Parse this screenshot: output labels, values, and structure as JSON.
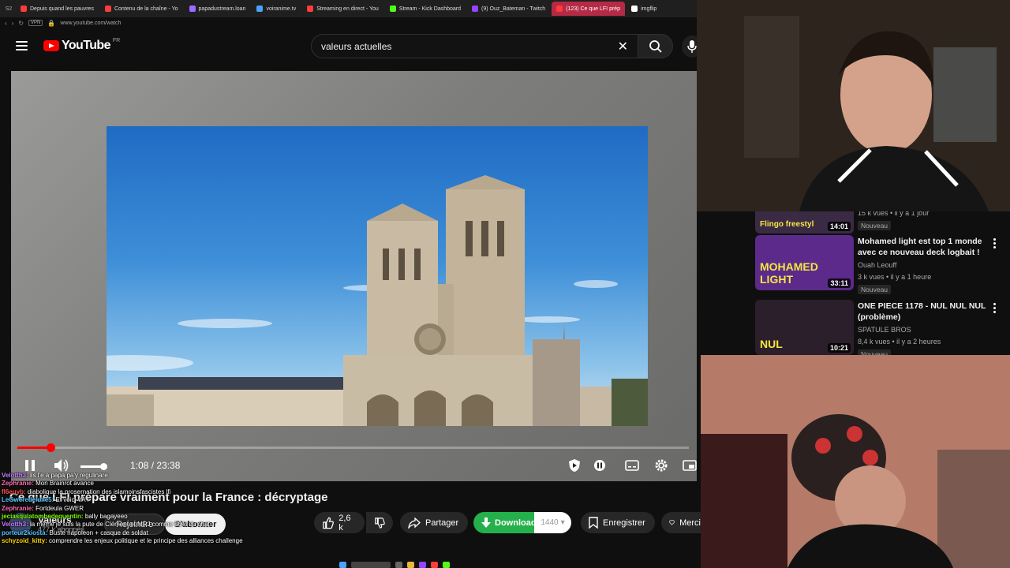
{
  "browser": {
    "tabs": [
      {
        "label": "Depuis quand les pauvres",
        "color": "#ff3b3b"
      },
      {
        "label": "Contenu de la chaîne - Yo",
        "color": "#ff3b3b"
      },
      {
        "label": "papadustream.loan",
        "color": "#9a6cff"
      },
      {
        "label": "voiranime.tv",
        "color": "#4aa3ff"
      },
      {
        "label": "Streaming en direct - You",
        "color": "#ff3b3b"
      },
      {
        "label": "Stream - Kick Dashboard",
        "color": "#53fc18"
      },
      {
        "label": "(9) Ouz_Bateman - Twitch",
        "color": "#9146ff"
      },
      {
        "label": "(123) Ce que LFI prép",
        "color": "#ff3b3b"
      },
      {
        "label": "imgflip",
        "color": "#ffffff"
      }
    ],
    "url": "www.youtube.com/watch"
  },
  "header": {
    "logo_text": "YouTube",
    "country_code": "FR",
    "search_value": "valeurs actuelles"
  },
  "player": {
    "time_display": "1:08 / 23:38",
    "progress_fraction": 0.049,
    "volume_fraction": 1.0
  },
  "video": {
    "title": "Ce que LFI prépare vraiment pour la France : décryptage",
    "channel_name": "Valeurs",
    "subscribers": "477 k abonnés",
    "join_label": "Rejoindre",
    "subscribe_label": "S'abonner",
    "likes": "2,6 k",
    "share_label": "Partager",
    "download_label": "Download",
    "download_quality": "1440",
    "save_label": "Enregistrer",
    "more_label": "Merci"
  },
  "recommendations": [
    {
      "thumb_text": "Flingo freestyl",
      "duration": "14:01",
      "title": "",
      "channel": "",
      "meta": "15 k vues • il y a 1 jour",
      "badge": "Nouveau"
    },
    {
      "thumb_text": "MOHAMED LIGHT",
      "duration": "33:11",
      "title": "Mohamed light est top 1 monde avec ce nouveau deck logbait !",
      "channel": "Ouah Leouff",
      "meta": "3 k vues • il y a 1 heure",
      "badge": "Nouveau"
    },
    {
      "thumb_text": "NUL",
      "duration": "10:21",
      "title": "ONE PIECE 1178 - NUL NUL NUL (problème)",
      "channel": "SPATULE BROS",
      "meta": "8,4 k vues • il y a 2 heures",
      "badge": "Nouveau"
    }
  ],
  "chat": [
    {
      "user": "Velotth3:",
      "text": "ils l'e à papa pa'y regulinare",
      "color": "#c77dff"
    },
    {
      "user": "Zephranie:",
      "text": "Mon Brainrot avance",
      "color": "#ff69b4"
    },
    {
      "user": "fl6euyb:",
      "text": "diabolique la prosernation des islamoinsfascistes lfi",
      "color": "#ff4d4d"
    },
    {
      "user": "LeGweredeluxe5:",
      "text": "Et voici VA !",
      "color": "#4dc3ff"
    },
    {
      "user": "Zephranie:",
      "text": "Fortdeula GWER",
      "color": "#ff69b4"
    },
    {
      "user": "jeciasqulatombedequentin:",
      "text": "bally bagayeeo",
      "color": "#7cfc00"
    },
    {
      "user": "Velotth3:",
      "text": "la même je suis la pute de Clément et MRJ comme 50% du chat",
      "color": "#c77dff"
    },
    {
      "user": "porteur2kiosta:",
      "text": "Buste napoleon + casque de soldat",
      "color": "#4dc3ff"
    },
    {
      "user": "schyzoid_kitty:",
      "text": "comprendre les enjeux politique et le principe des alliances challenge",
      "color": "#ffd700"
    }
  ]
}
